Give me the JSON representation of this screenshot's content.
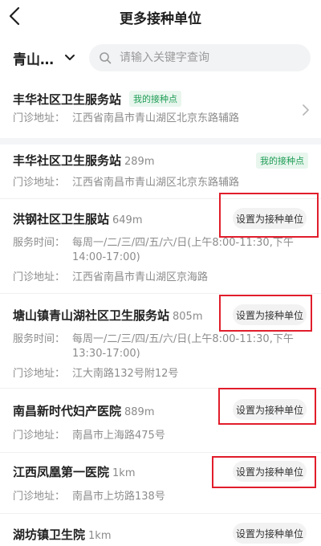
{
  "header": {
    "title": "更多接种单位"
  },
  "filter": {
    "region": "青山…",
    "search_placeholder": "请输入关键字查询"
  },
  "my_unit": {
    "name": "丰华社区卫生服务站",
    "badge": "我的接种点",
    "address_label": "门诊地址：",
    "address": "江西省南昌市青山湖区北京东路辅路"
  },
  "labels": {
    "hours": "服务时间：",
    "address": "门诊地址：",
    "set_button": "设置为接种单位",
    "my_badge": "我的接种点"
  },
  "units": [
    {
      "name": "丰华社区卫生服务站",
      "distance": "289m",
      "address": "江西省南昌市青山湖区北京东路辅路"
    },
    {
      "name": "洪钢社区卫生服站",
      "distance": "649m",
      "hours": "每周一/二/三/四/五/六/日(上午8:00-11:30,下午14:00-17:00)",
      "address": "江西省南昌市青山湖区京海路"
    },
    {
      "name": "塘山镇青山湖社区卫生服务站",
      "distance": "805m",
      "hours": "每周一/二/三/四/五/六/日(上午8:00-11:30,下午13:30-17:00)",
      "address": "江大南路132号附12号"
    },
    {
      "name": "南昌新时代妇产医院",
      "distance": "889m",
      "address": "南昌市上海路475号"
    },
    {
      "name": "江西凤凰第一医院",
      "distance": "1km",
      "address": "南昌市上坊路138号"
    },
    {
      "name": "湖坊镇卫生院",
      "distance": "1km"
    }
  ],
  "colors": {
    "badge_green": "#1f9d55",
    "highlight_red": "#e11d2b"
  }
}
